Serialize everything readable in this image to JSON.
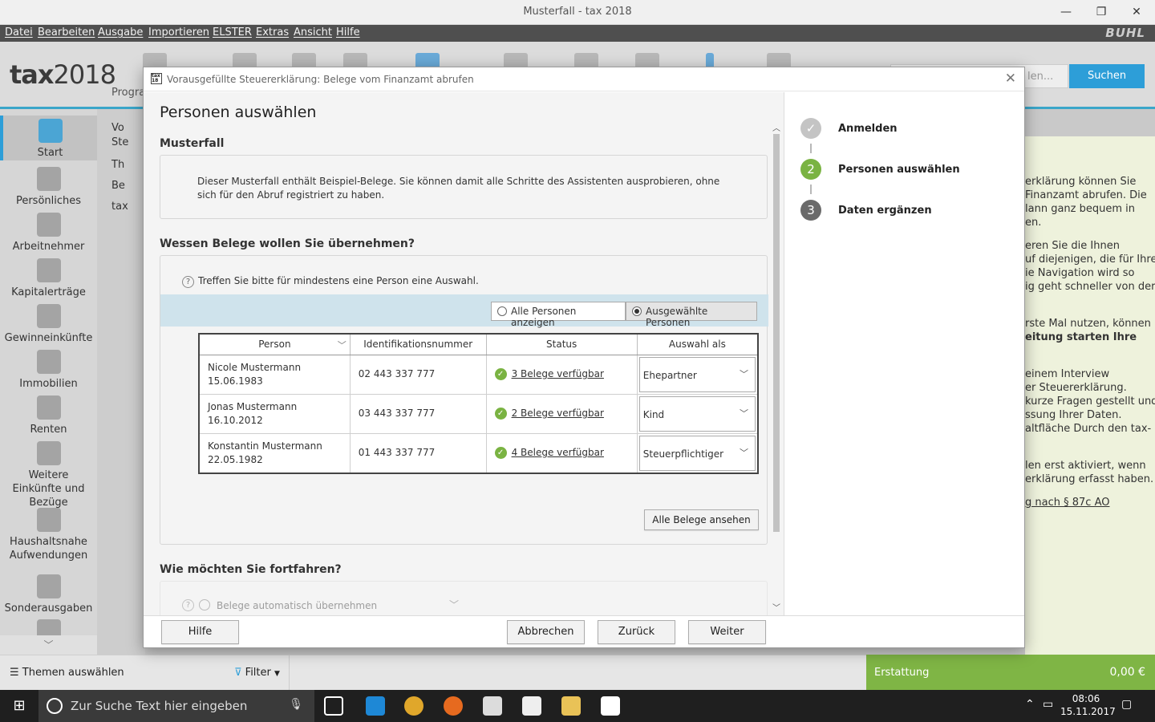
{
  "window": {
    "title": "Musterfall - tax 2018",
    "minimize": "—",
    "maximize": "❐",
    "close": "✕"
  },
  "menu": [
    "Datei",
    "Bearbeiten",
    "Ausgabe",
    "Importieren",
    "ELSTER",
    "Extras",
    "Ansicht",
    "Hilfe"
  ],
  "brand": "BUHL",
  "toolbar": {
    "logo_prefix": "tax",
    "logo_year": "2018",
    "label_partial": "Progra",
    "search_placeholder": "len...",
    "search_button": "Suchen"
  },
  "leftnav": [
    {
      "label": "Start",
      "icon": "signpost-icon"
    },
    {
      "label": "Persönliches",
      "icon": "person-card-icon"
    },
    {
      "label": "Arbeitnehmer",
      "icon": "employee-card-icon"
    },
    {
      "label": "Kapitalerträge",
      "icon": "capital-icon"
    },
    {
      "label": "Gewinneinkünfte",
      "icon": "businessman-icon"
    },
    {
      "label": "Immobilien",
      "icon": "house-icon"
    },
    {
      "label": "Renten",
      "icon": "pensioner-icon"
    },
    {
      "label": "Weitere Einkünfte und Bezüge",
      "icon": "hand-coins-icon"
    },
    {
      "label": "Haushaltsnahe Aufwendungen",
      "icon": "household-icon"
    },
    {
      "label": "Sonderausgaben",
      "icon": "church-icon"
    }
  ],
  "subnav": [
    "Vo",
    "Ste",
    "Th",
    "Be",
    "tax"
  ],
  "rightpane": {
    "lines": [
      "erklärung können Sie",
      "Finanzamt abrufen. Die",
      "lann ganz bequem in",
      "en.",
      "eren Sie die Ihnen",
      "uf diejenigen, die für Ihre",
      "ie Navigation wird so",
      "ig geht schneller von der",
      "rste Mal nutzen, können",
      "eitung starten Ihre",
      "einem Interview",
      "er Steuererklärung.",
      "kurze Fragen gestellt und",
      "ssung Ihrer Daten.",
      "altfläche Durch den tax-",
      "len erst aktiviert, wenn",
      "erklärung erfasst haben.",
      "g nach § 87c AO"
    ]
  },
  "bottombar": {
    "themen": "Themen auswählen",
    "filter": "Filter",
    "erstattung_label": "Erstattung",
    "erstattung_value": "0,00 €"
  },
  "taskbar": {
    "search": "Zur Suche Text hier eingeben",
    "time": "08:06",
    "date": "15.11.2017"
  },
  "dialog": {
    "title": "Vorausgefüllte Steuererklärung: Belege vom Finanzamt abrufen",
    "heading": "Personen auswählen",
    "section1_title": "Musterfall",
    "section1_text": "Dieser Musterfall enthält Beispiel-Belege. Sie können damit alle Schritte des Assistenten ausprobieren, ohne sich für den Abruf registriert zu haben.",
    "section2_title": "Wessen Belege wollen Sie übernehmen?",
    "hint": "Treffen Sie bitte für mindestens eine Person eine Auswahl.",
    "toggle_all": "Alle Personen anzeigen",
    "toggle_selected": "Ausgewählte Personen",
    "columns": [
      "Person",
      "Identifikationsnummer",
      "Status",
      "Auswahl als"
    ],
    "rows": [
      {
        "name": "Nicole Mustermann",
        "birth": "15.06.1983",
        "id": "02 443 337 777",
        "status": "3 Belege verfügbar",
        "role": "Ehepartner"
      },
      {
        "name": "Jonas Mustermann",
        "birth": "16.10.2012",
        "id": "03 443 337 777",
        "status": "2 Belege verfügbar",
        "role": "Kind"
      },
      {
        "name": "Konstantin Mustermann",
        "birth": "22.05.1982",
        "id": "01 443 337 777",
        "status": "4 Belege verfügbar",
        "role": "Steuerpflichtiger"
      }
    ],
    "all_docs_button": "Alle Belege ansehen",
    "section3_title": "Wie möchten Sie fortfahren?",
    "section3_option": "Belege automatisch übernehmen",
    "steps": [
      {
        "num": "✓",
        "label": "Anmelden",
        "state": "done"
      },
      {
        "num": "2",
        "label": "Personen auswählen",
        "state": "active"
      },
      {
        "num": "3",
        "label": "Daten ergänzen",
        "state": "pending"
      }
    ],
    "buttons": {
      "help": "Hilfe",
      "cancel": "Abbrechen",
      "back": "Zurück",
      "next": "Weiter"
    }
  },
  "colors": {
    "accent": "#2d9ed8",
    "green": "#7ab342",
    "erstattung": "#7fb545",
    "step_done": "#b8b8b8",
    "step_pending": "#6a6a6a"
  }
}
